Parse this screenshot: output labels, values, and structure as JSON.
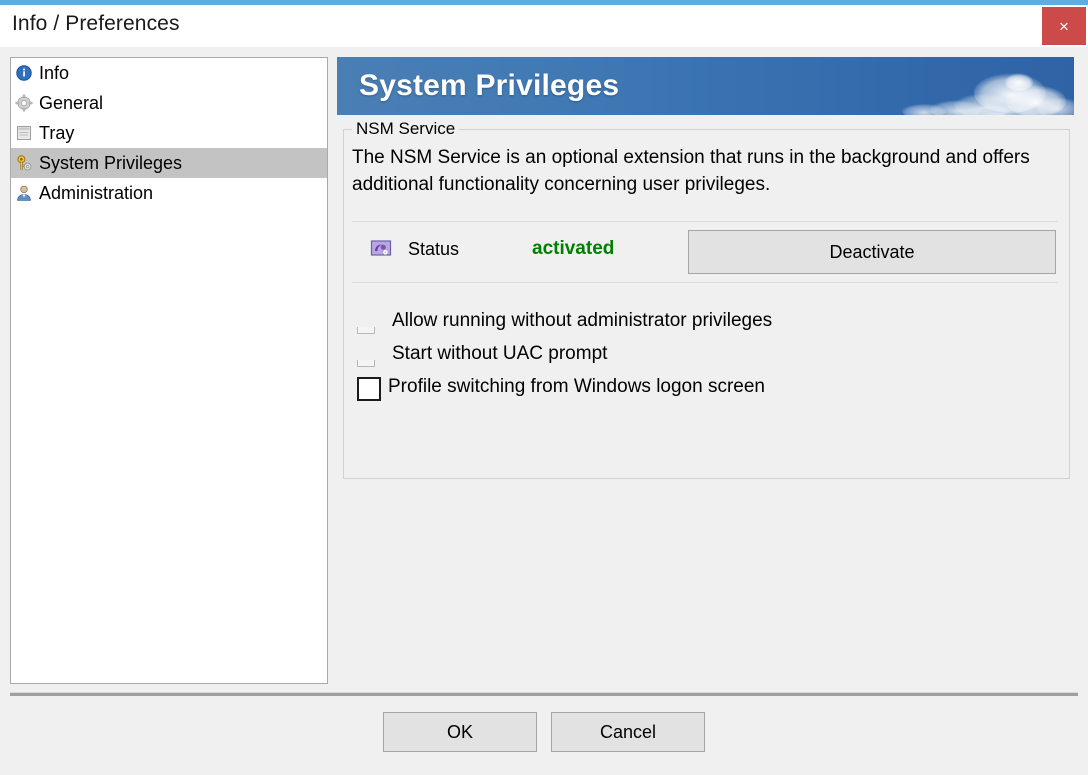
{
  "window": {
    "title": "Info / Preferences",
    "close_label": "×",
    "accent_color": "#5cade0",
    "close_button_color": "#cc4a4a",
    "body_background": "#f0f0f0"
  },
  "sidebar": {
    "items": [
      {
        "label": "Info",
        "icon": "info-icon",
        "selected": false
      },
      {
        "label": "General",
        "icon": "gear-icon",
        "selected": false
      },
      {
        "label": "Tray",
        "icon": "window-icon",
        "selected": false
      },
      {
        "label": "System Privileges",
        "icon": "key-gear-icon",
        "selected": true
      },
      {
        "label": "Administration",
        "icon": "user-icon",
        "selected": false
      }
    ],
    "selected_background": "#c3c3c3"
  },
  "banner": {
    "title": "System Privileges",
    "gradient_from": "#4a7fb5",
    "gradient_to": "#2f63a6",
    "text_color": "#ffffff"
  },
  "group": {
    "title": "NSM Service",
    "description": "The NSM Service is an optional extension that runs in the background and offers additional functionality concerning user privileges."
  },
  "status": {
    "icon": "service-icon",
    "label": "Status",
    "value": "activated",
    "value_color": "#008000",
    "button_label": "Deactivate"
  },
  "options": [
    {
      "label": "Allow running without administrator privileges",
      "checked": false,
      "style": "clipped"
    },
    {
      "label": "Start without UAC prompt",
      "checked": false,
      "style": "clipped"
    },
    {
      "label": "Profile switching from Windows logon screen",
      "checked": false,
      "style": "full"
    }
  ],
  "footer": {
    "ok_label": "OK",
    "cancel_label": "Cancel"
  }
}
